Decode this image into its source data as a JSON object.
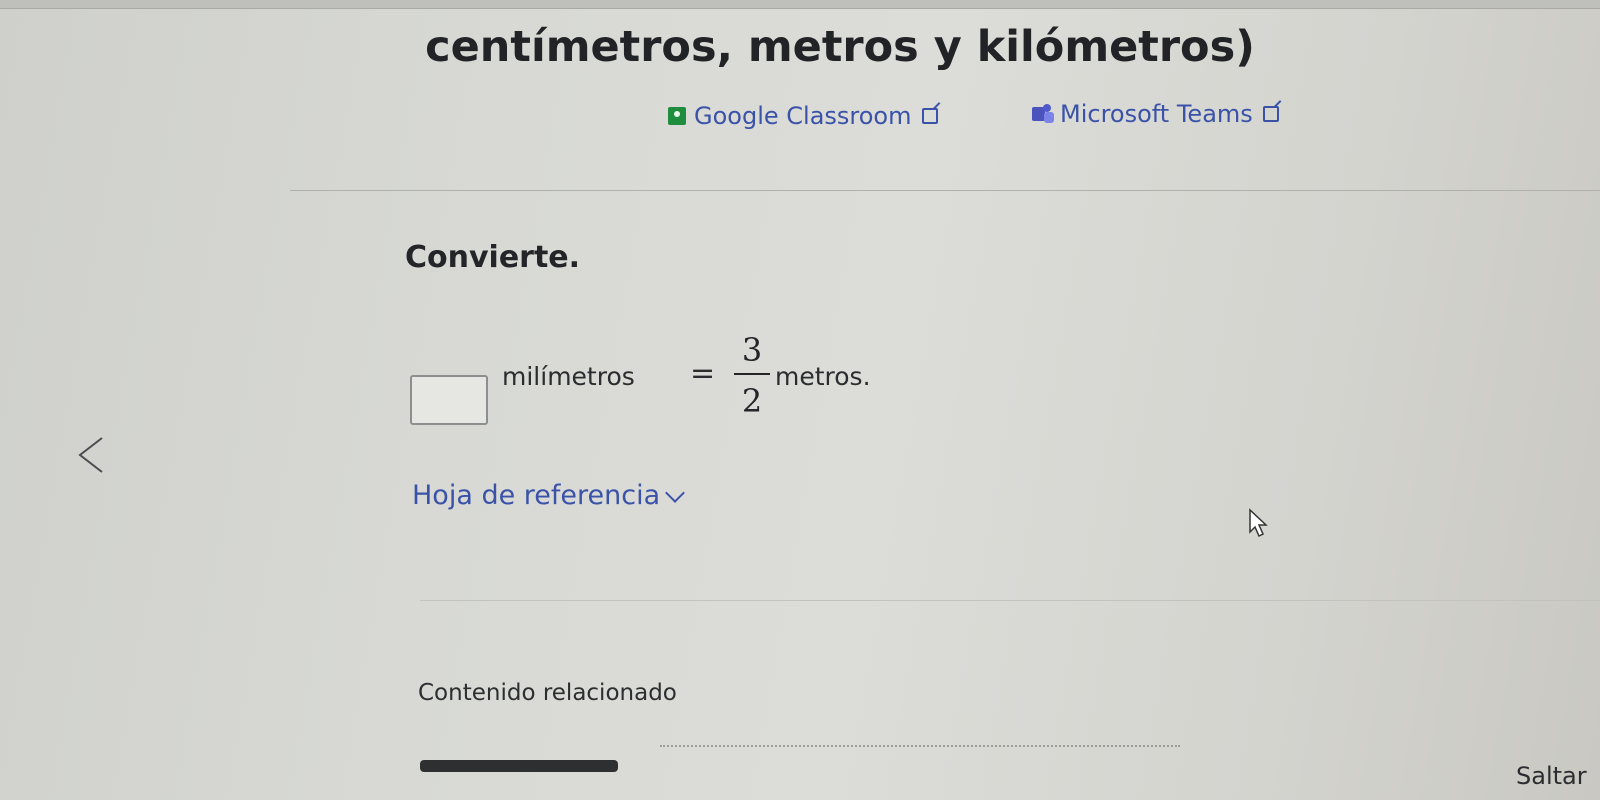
{
  "page": {
    "title": "centímetros, metros y kilómetros)"
  },
  "share": {
    "classroom_label": "Google Classroom",
    "teams_label": "Microsoft Teams",
    "classroom_icon": "google-classroom-icon",
    "teams_icon": "microsoft-teams-icon"
  },
  "exercise": {
    "prompt": "Convierte.",
    "answer_value": "",
    "unit_left": "milímetros",
    "equals": "=",
    "fraction_numerator": "3",
    "fraction_denominator": "2",
    "unit_right": "metros."
  },
  "reference": {
    "label": "Hoja de referencia"
  },
  "related": {
    "label": "Contenido relacionado"
  },
  "footer": {
    "skip_label": "Saltar"
  },
  "colors": {
    "link": "#3a53a8",
    "text": "#232529",
    "background": "#d8d9d5"
  }
}
